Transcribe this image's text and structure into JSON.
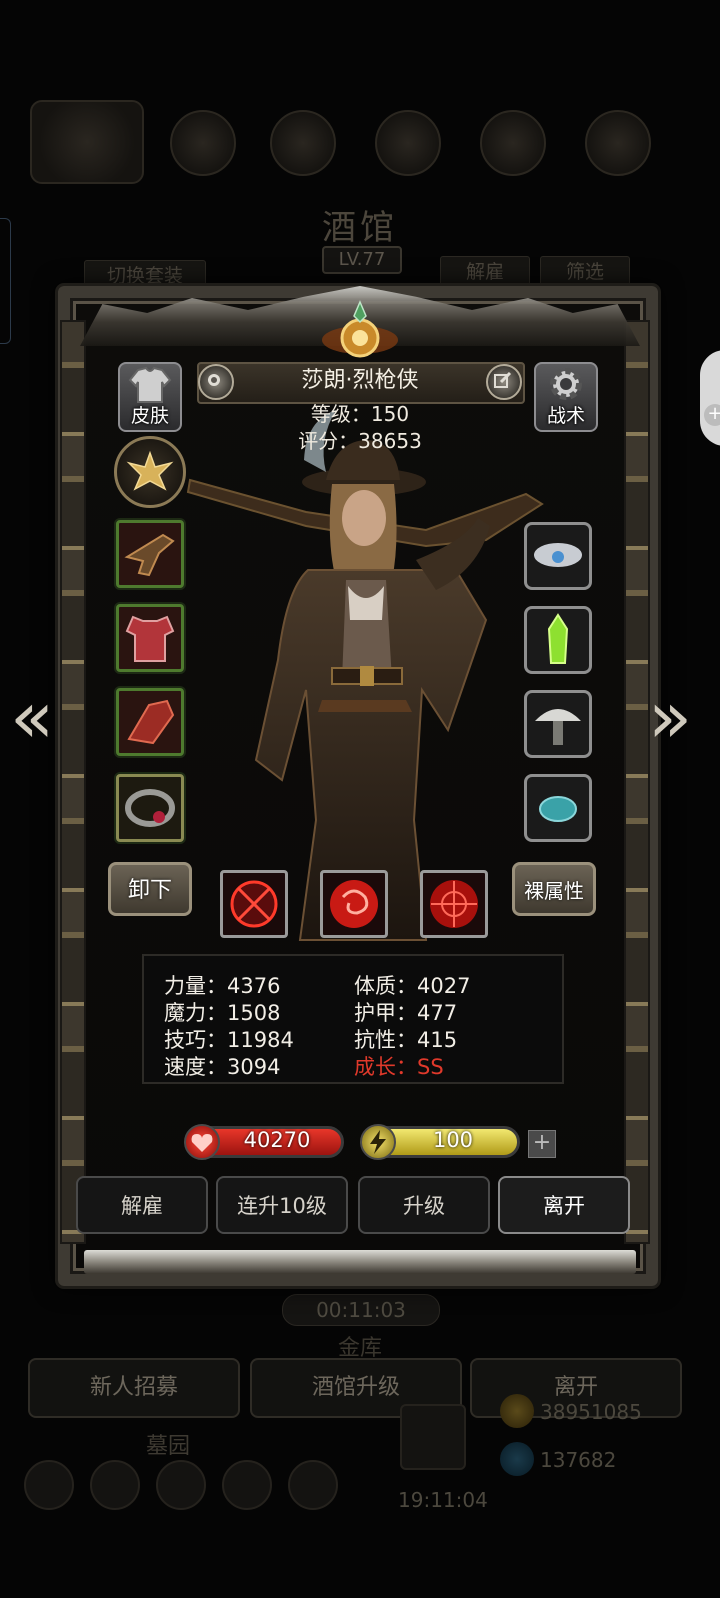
{
  "background": {
    "title": "酒馆",
    "level": "LV.77",
    "tabs": {
      "switch_set": "切换套装",
      "dismiss": "解雇",
      "filter": "筛选"
    },
    "timer": "00:11:03",
    "gold_label": "金库",
    "buttons": {
      "recruit": "新人招募",
      "upgrade_tavern": "酒馆升级",
      "leave": "离开"
    },
    "graveyard": "墓园",
    "clock": "19:11:04",
    "gold": "38951085",
    "gems": "137682"
  },
  "hero": {
    "name": "莎朗·烈枪侠",
    "level_text": "等级：150",
    "score_text": "评分：38653",
    "skin_label": "皮肤",
    "tactics_label": "战术"
  },
  "actions": {
    "unequip": "卸下",
    "naked_stats": "裸属性"
  },
  "stats": {
    "strength": "力量：4376",
    "magic": "魔力：1508",
    "skill": "技巧：11984",
    "speed": "速度：3094",
    "constitution": "体质：4027",
    "armor": "护甲：477",
    "resistance": "抗性：415",
    "growth": "成长：SS"
  },
  "resources": {
    "hp": "40270",
    "energy": "100",
    "plus": "+"
  },
  "bottom_buttons": {
    "dismiss": "解雇",
    "level_up_10": "连升10级",
    "level_up": "升级",
    "leave": "离开"
  },
  "nav": {
    "prev": "«",
    "next": "»"
  },
  "icons": {
    "skin": "shirt-icon",
    "tactics": "gear-icon",
    "emblem": "phoenix-emblem-icon",
    "settings": "settings-icon",
    "edit": "edit-icon",
    "hp": "heart-icon",
    "energy": "lightning-icon"
  },
  "colors": {
    "growth": "#e0392b",
    "hp": "#d42a1e",
    "energy": "#e6d84a"
  }
}
